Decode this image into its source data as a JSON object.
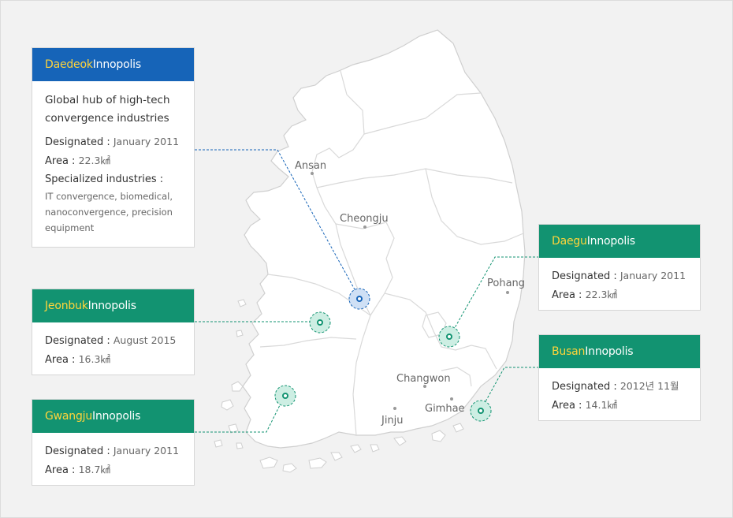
{
  "cards": {
    "daedeok": {
      "city": "Daedeok",
      "suffix": "Innopolis",
      "desc_line1": "Global hub of high-tech",
      "desc_line2": "convergence industries",
      "designated_label": "Designated :",
      "designated_value": "January 2011",
      "area_label": "Area :",
      "area_value": "22.3㎢",
      "industries_label": "Specialized industries :",
      "industries_line1": "IT convergence, biomedical,",
      "industries_line2": "nanoconvergence, precision",
      "industries_line3": "equipment"
    },
    "jeonbuk": {
      "city": "Jeonbuk",
      "suffix": "Innopolis",
      "designated_label": "Designated :",
      "designated_value": "August 2015",
      "area_label": "Area :",
      "area_value": "16.3㎢"
    },
    "gwangju": {
      "city": "Gwangju",
      "suffix": "Innopolis",
      "designated_label": "Designated :",
      "designated_value": "January 2011",
      "area_label": "Area :",
      "area_value": "18.7㎢"
    },
    "daegu": {
      "city": "Daegu",
      "suffix": "Innopolis",
      "designated_label": "Designated :",
      "designated_value": "January 2011",
      "area_label": "Area :",
      "area_value": "22.3㎢"
    },
    "busan": {
      "city": "Busan",
      "suffix": "Innopolis",
      "designated_label": "Designated :",
      "designated_value": "2012년 11월",
      "area_label": "Area :",
      "area_value": "14.1㎢"
    }
  },
  "map_labels": {
    "ansan": "Ansan",
    "cheongju": "Cheongju",
    "pohang": "Pohang",
    "changwon": "Changwon",
    "gimhae": "Gimhae",
    "jinju": "Jinju"
  },
  "colors": {
    "blue_header": "#1664b8",
    "green_header": "#129371",
    "city_highlight": "#ffd43a",
    "map_fill": "#ffffff"
  }
}
